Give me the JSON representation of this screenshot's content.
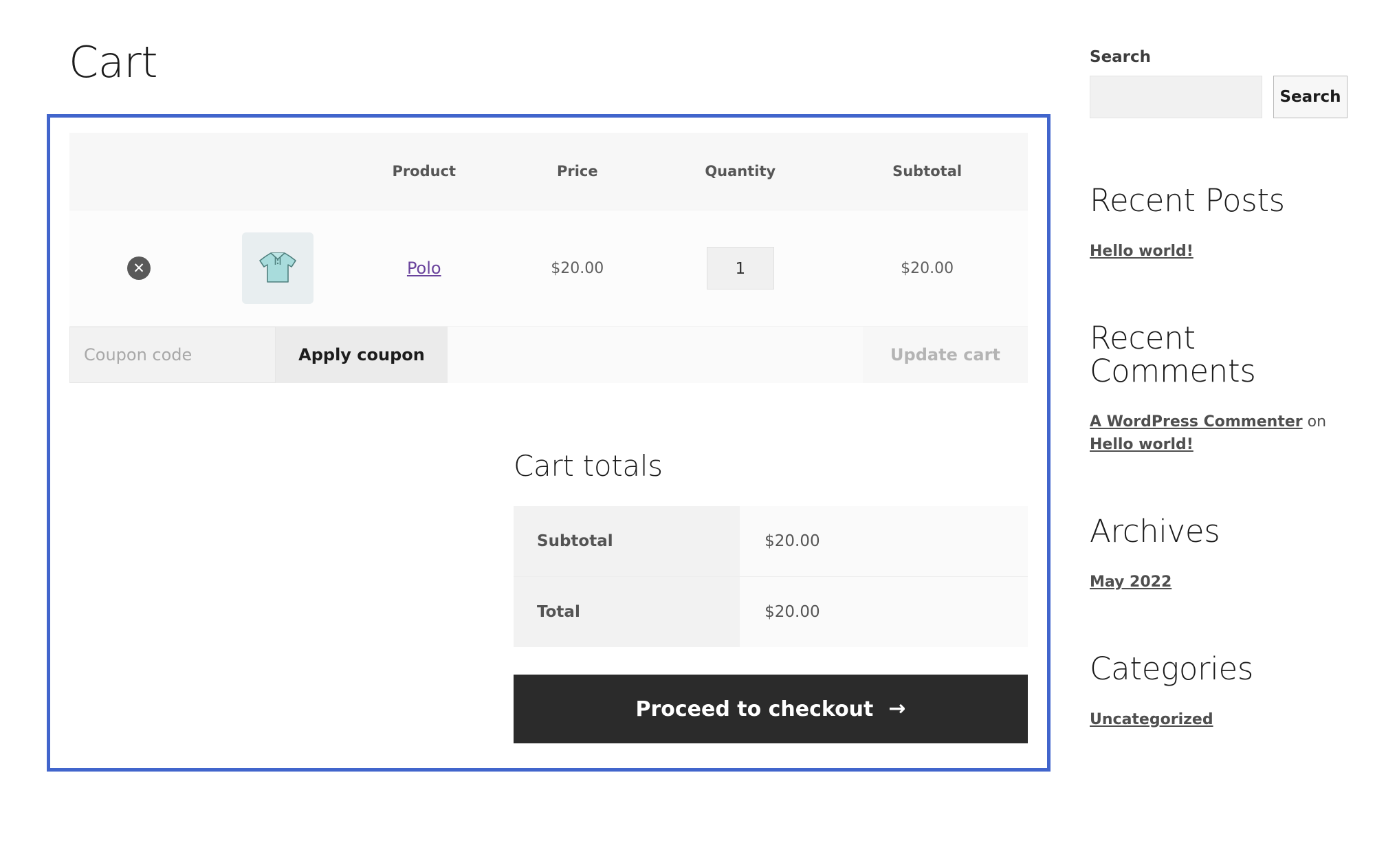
{
  "page": {
    "title": "Cart",
    "highlight_color": "#4165cc"
  },
  "cart_table": {
    "headers": {
      "remove": "",
      "thumbnail": "",
      "product": "Product",
      "price": "Price",
      "quantity": "Quantity",
      "subtotal": "Subtotal"
    },
    "rows": [
      {
        "remove_icon": "remove-item-icon",
        "thumbnail_icon": "polo-shirt-thumbnail",
        "product_name": "Polo",
        "price": "$20.00",
        "quantity": "1",
        "subtotal": "$20.00"
      }
    ]
  },
  "coupon": {
    "placeholder": "Coupon code",
    "value": "",
    "apply_label": "Apply coupon",
    "update_label": "Update cart"
  },
  "totals": {
    "heading": "Cart totals",
    "rows": [
      {
        "label": "Subtotal",
        "value": "$20.00"
      },
      {
        "label": "Total",
        "value": "$20.00"
      }
    ],
    "checkout_label": "Proceed to checkout",
    "checkout_arrow": "→"
  },
  "sidebar": {
    "search": {
      "label": "Search",
      "value": "",
      "placeholder": "",
      "button_label": "Search"
    },
    "recent_posts": {
      "title": "Recent Posts",
      "items": [
        "Hello world!"
      ]
    },
    "recent_comments": {
      "title": "Recent Comments",
      "items": [
        {
          "author": "A WordPress Commenter",
          "connector": " on ",
          "post": "Hello world!"
        }
      ]
    },
    "archives": {
      "title": "Archives",
      "items": [
        "May 2022"
      ]
    },
    "categories": {
      "title": "Categories",
      "items": [
        "Uncategorized"
      ]
    }
  }
}
